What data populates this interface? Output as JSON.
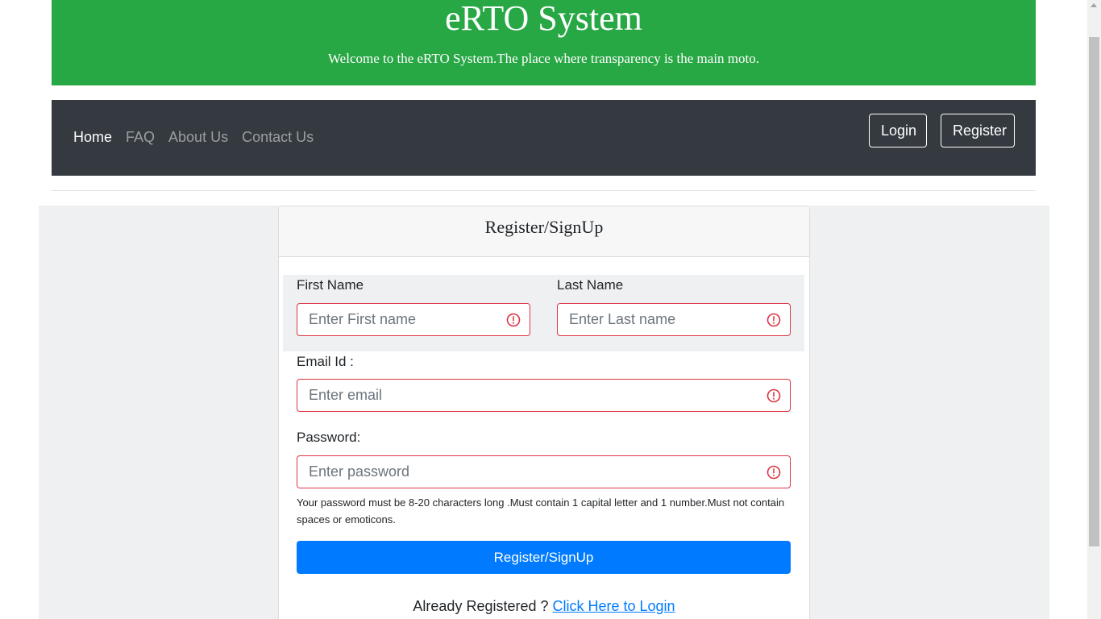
{
  "banner": {
    "title": "eRTO System",
    "subtitle": "Welcome to the eRTO System.The place where transparency is the main moto."
  },
  "nav": {
    "links": [
      "Home",
      "FAQ",
      "About Us",
      "Contact Us"
    ],
    "active": "Home",
    "login_label": "Login",
    "register_label": "Register"
  },
  "form": {
    "title": "Register/SignUp",
    "first_name": {
      "label": "First Name",
      "placeholder": "Enter First name",
      "value": ""
    },
    "last_name": {
      "label": "Last Name",
      "placeholder": "Enter Last name",
      "value": ""
    },
    "email": {
      "label": "Email Id :",
      "placeholder": "Enter email",
      "value": ""
    },
    "password": {
      "label": "Password:",
      "placeholder": "Enter password",
      "value": ""
    },
    "password_help": "Your password must be 8-20 characters long .Must contain 1 capital letter and 1 number.Must not contain spaces or emoticons.",
    "submit_label": "Register/SignUp",
    "already_text": "Already Registered ? ",
    "login_link": "Click Here to Login"
  },
  "colors": {
    "banner_bg": "#28a745",
    "navbar_bg": "#343a40",
    "primary": "#007bff",
    "error": "#dc3545"
  },
  "icons": {
    "field_error": "exclamation-circle-icon"
  }
}
